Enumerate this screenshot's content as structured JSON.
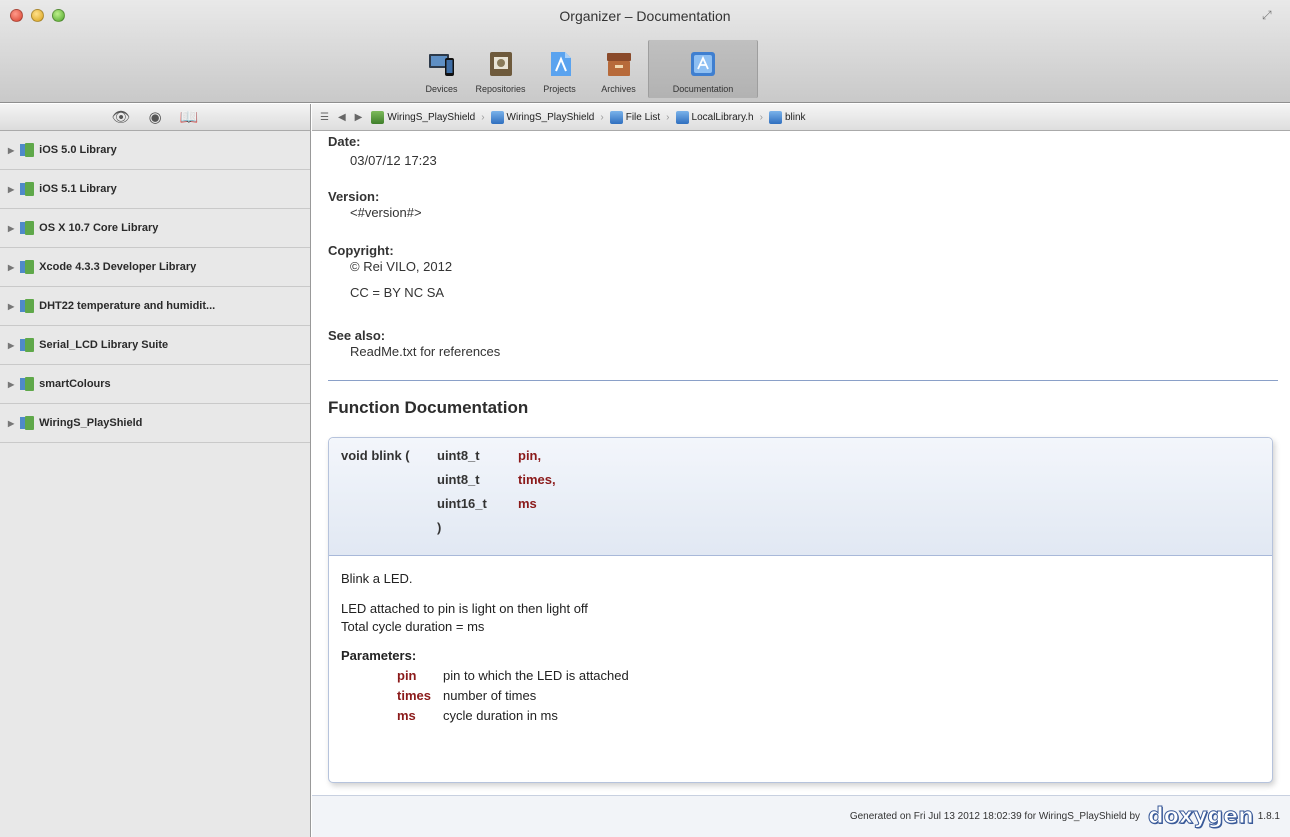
{
  "window": {
    "title": "Organizer – Documentation"
  },
  "toolbar": {
    "items": [
      {
        "label": "Devices",
        "icon": "devices-icon"
      },
      {
        "label": "Repositories",
        "icon": "repositories-icon"
      },
      {
        "label": "Projects",
        "icon": "projects-icon"
      },
      {
        "label": "Archives",
        "icon": "archives-icon"
      },
      {
        "label": "Documentation",
        "icon": "documentation-icon"
      }
    ],
    "active": "Documentation"
  },
  "sidebar": {
    "header_icons": [
      "eye-icon",
      "search-icon",
      "bookmarks-icon"
    ],
    "items": [
      {
        "label": "iOS 5.0 Library"
      },
      {
        "label": "iOS 5.1 Library"
      },
      {
        "label": "OS X 10.7 Core Library"
      },
      {
        "label": "Xcode 4.3.3 Developer Library"
      },
      {
        "label": "DHT22 temperature and humidit..."
      },
      {
        "label": "Serial_LCD Library Suite"
      },
      {
        "label": "smartColours"
      },
      {
        "label": "WiringS_PlayShield"
      }
    ]
  },
  "pathbar": {
    "crumbs": [
      {
        "label": "WiringS_PlayShield"
      },
      {
        "label": "WiringS_PlayShield"
      },
      {
        "label": "File List"
      },
      {
        "label": "LocalLibrary.h"
      },
      {
        "label": "blink"
      }
    ]
  },
  "doc": {
    "date_label": "Date:",
    "date_value": "03/07/12 17:23",
    "version_label": "Version:",
    "version_value": "<#version#>",
    "copyright_label": "Copyright:",
    "copyright_line1": "© Rei VILO, 2012",
    "copyright_line2": "CC = BY NC SA",
    "seealso_label": "See also:",
    "seealso_value": "ReadMe.txt for references",
    "function_heading": "Function Documentation",
    "proto": {
      "name": "void blink (",
      "params": [
        {
          "type": "uint8_t",
          "name": "pin,"
        },
        {
          "type": "uint8_t",
          "name": "times,"
        },
        {
          "type": "uint16_t",
          "name": "ms"
        }
      ],
      "close": ")"
    },
    "brief": "Blink a LED.",
    "detail_line1": "LED attached to pin is light on then light off",
    "detail_line2": "Total cycle duration = ms",
    "params_title": "Parameters:",
    "params": [
      {
        "name": "pin",
        "desc": "pin to which the LED is attached"
      },
      {
        "name": "times",
        "desc": "number of times"
      },
      {
        "name": "ms",
        "desc": "cycle duration in ms"
      }
    ]
  },
  "footer": {
    "generated": "Generated on Fri Jul 13 2012 18:02:39 for WiringS_PlayShield by",
    "logo": "doxygen",
    "version": "1.8.1"
  }
}
